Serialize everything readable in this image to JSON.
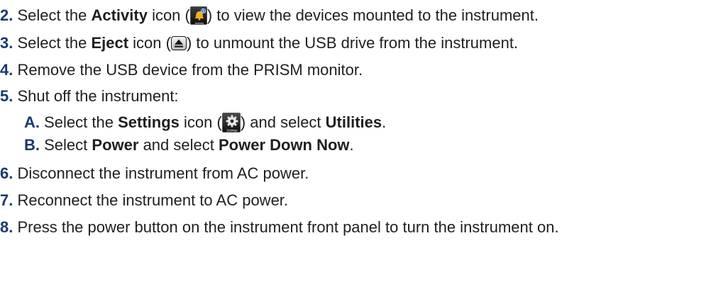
{
  "steps": {
    "s2": {
      "num": "2.",
      "pre": "Select the",
      "bold": "Activity",
      "mid": "icon (",
      "icon_name": "activity-icon",
      "icon_caption": "Activity",
      "post": ") to view the devices mounted to the instrument."
    },
    "s3": {
      "num": "3.",
      "pre": "Select the",
      "bold": "Eject",
      "mid": "icon (",
      "icon_name": "eject-icon",
      "post": ") to unmount the USB drive from the instrument."
    },
    "s4": {
      "num": "4.",
      "text": "Remove the USB device from the PRISM monitor."
    },
    "s5": {
      "num": "5.",
      "text": "Shut off the instrument:",
      "a": {
        "num": "A.",
        "pre": "Select the",
        "bold1": "Settings",
        "mid": "icon (",
        "icon_name": "settings-icon",
        "icon_caption": "Settings",
        "post": ") and select",
        "bold2": "Utilities",
        "end": "."
      },
      "b": {
        "num": "B.",
        "pre": "Select",
        "bold1": "Power",
        "mid": "and select",
        "bold2": "Power Down Now",
        "end": "."
      }
    },
    "s6": {
      "num": "6.",
      "text": "Disconnect the instrument from AC power."
    },
    "s7": {
      "num": "7.",
      "text": "Reconnect the instrument to AC power."
    },
    "s8": {
      "num": "8.",
      "text": "Press the power button on the instrument front panel to turn the instrument on."
    }
  },
  "colors": {
    "step_number": "#173a6c",
    "body_text": "#1f1f1f"
  }
}
